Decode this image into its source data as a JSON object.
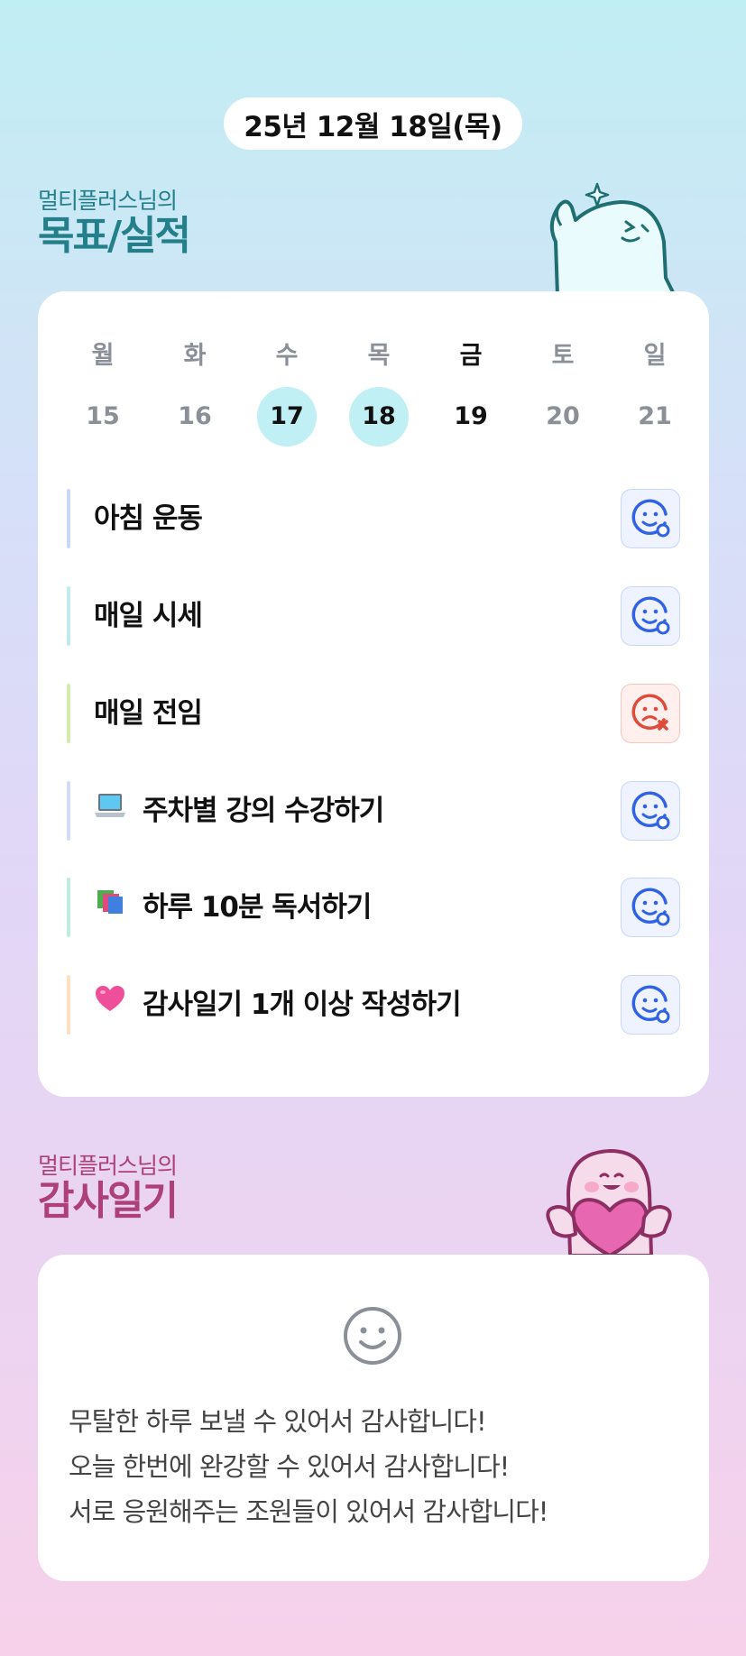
{
  "header": {
    "date": "25년 12월 18일(목)"
  },
  "goals_section": {
    "subtitle": "멀티플러스님의",
    "title": "목표/실적"
  },
  "week": [
    {
      "name": "월",
      "num": "15",
      "state": "none"
    },
    {
      "name": "화",
      "num": "16",
      "state": "none"
    },
    {
      "name": "수",
      "num": "17",
      "state": "done"
    },
    {
      "name": "목",
      "num": "18",
      "state": "done"
    },
    {
      "name": "금",
      "num": "19",
      "state": "today"
    },
    {
      "name": "토",
      "num": "20",
      "state": "none"
    },
    {
      "name": "일",
      "num": "21",
      "state": "none"
    }
  ],
  "goals": [
    {
      "label": "아침 운동",
      "emoji": "",
      "bar_color": "#c9d8f7",
      "status": "success",
      "status_icon": "smile-check-icon"
    },
    {
      "label": "매일 시세",
      "emoji": "",
      "bar_color": "#bfeaf0",
      "status": "success",
      "status_icon": "smile-check-icon"
    },
    {
      "label": "매일 전임",
      "emoji": "",
      "bar_color": "#d3ecb0",
      "status": "fail",
      "status_icon": "sad-x-icon"
    },
    {
      "label": "주차별 강의 수강하기",
      "emoji": "laptop-icon",
      "bar_color": "#d2dcf6",
      "status": "success",
      "status_icon": "smile-check-icon"
    },
    {
      "label": "하루 10분 독서하기",
      "emoji": "books-icon",
      "bar_color": "#bdeedd",
      "status": "success",
      "status_icon": "smile-check-icon"
    },
    {
      "label": "감사일기 1개 이상 작성하기",
      "emoji": "heart-icon",
      "bar_color": "#fde0c2",
      "status": "success",
      "status_icon": "smile-check-icon"
    }
  ],
  "diary_section": {
    "subtitle": "멀티플러스님의",
    "title": "감사일기"
  },
  "diary": {
    "icon": "smile-face-icon",
    "lines": [
      "무탈한 하루 보낼 수 있어서 감사합니다!",
      "오늘 한번에 완강할 수 있어서 감사합니다!",
      "서로 응원해주는 조원들이 있어서 감사합니다!"
    ]
  },
  "colors": {
    "goals_title": "#23808a",
    "diary_title": "#ad3f7a",
    "done_circle": "#c0eff4",
    "success_icon": "#2f62e6",
    "fail_icon": "#e04a38"
  }
}
